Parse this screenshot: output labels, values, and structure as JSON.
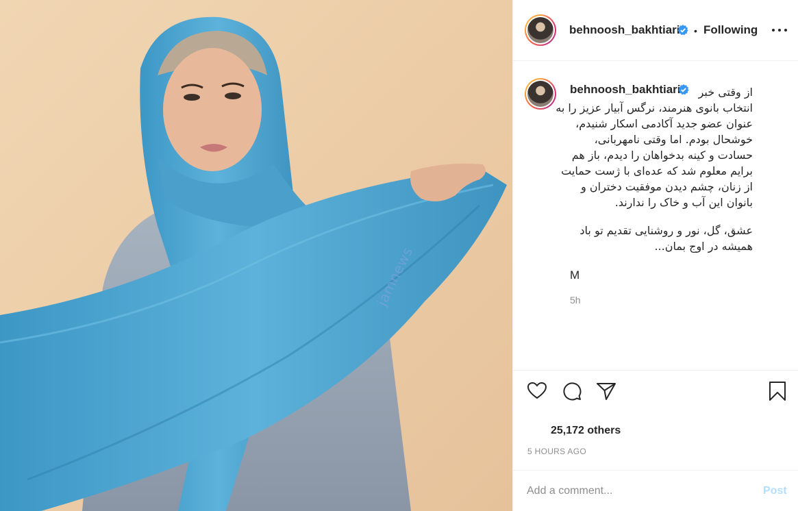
{
  "post": {
    "username": "behnoosh_bakhtiari",
    "follow_status": "Following",
    "separator": "•",
    "watermark": "jamnews",
    "caption_lines": [
      "از وقتی خبر",
      "انتخاب بانوی هنرمند، نرگس آبیار عزیز را به",
      "عنوان عضو جدید آکادمی اسکار شنیدم،",
      "خوشحال بودم. اما وقتی نامهربانی،",
      "حسادت و کینه بدخواهان را دیدم، باز هم",
      "برایم معلوم شد که عده‌ای با ژست حمایت",
      "از زنان، چشم دیدن موفقیت دختران و",
      "بانوان این آب و خاک را ندارند."
    ],
    "caption_lines_2": [
      "عشق، گل، نور و روشنایی تقدیم تو باد",
      "همیشه در اوج بمان..."
    ],
    "signature": "M",
    "relative_time": "5h",
    "likes_text": "25,172 others",
    "timestamp": "5 HOURS AGO",
    "comment_placeholder": "Add a comment...",
    "post_label": "Post"
  },
  "icons": {
    "like": "heart-icon",
    "comment": "comment-icon",
    "share": "paper-plane-icon",
    "save": "bookmark-icon",
    "verified": "verified-badge-icon",
    "more": "more-options-icon"
  },
  "colors": {
    "text": "#262626",
    "muted": "#8e8e8e",
    "border": "#efefef",
    "verified": "#3897f0",
    "post_disabled": "#b2dffc",
    "scarf": "#4fa6cf"
  }
}
